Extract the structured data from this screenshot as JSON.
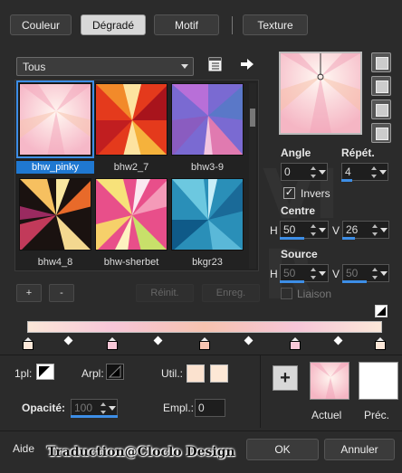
{
  "tabs": [
    {
      "label": "Couleur"
    },
    {
      "label": "Dégradé"
    },
    {
      "label": "Motif"
    },
    {
      "label": "Texture"
    }
  ],
  "category_dropdown": {
    "value": "Tous"
  },
  "gradients": [
    {
      "label": "bhw_pinky",
      "selected": true
    },
    {
      "label": "bhw2_7"
    },
    {
      "label": "bhw3-9"
    },
    {
      "label": "bhw4_8"
    },
    {
      "label": "bhw-sherbet"
    },
    {
      "label": "bkgr23"
    }
  ],
  "list_buttons": {
    "add": "+",
    "remove": "-",
    "reset": "Réinit.",
    "save": "Enreg."
  },
  "angle": {
    "label": "Angle",
    "value": "0"
  },
  "repeat": {
    "label": "Répét.",
    "value": "4"
  },
  "invert": {
    "label": "Invers",
    "checked": true
  },
  "center": {
    "label": "Centre",
    "h_label": "H",
    "h_value": "50",
    "v_label": "V",
    "v_value": "26"
  },
  "source": {
    "label": "Source",
    "h_label": "H",
    "h_value": "50",
    "v_label": "V",
    "v_value": "50"
  },
  "link": {
    "label": "Liaison",
    "checked": false
  },
  "bottom": {
    "one_pl_label": "1pl:",
    "arpl_label": "Arpl:",
    "util_label": "Util.:",
    "opacity_label": "Opacité:",
    "opacity_value": "100",
    "empl_label": "Empl.:",
    "empl_value": "0",
    "add_button": "+",
    "current_label": "Actuel",
    "previous_label": "Préc."
  },
  "footer": {
    "help": "Aide",
    "credit": "Traduction@Cloclo Design",
    "ok": "OK",
    "cancel": "Annuler"
  },
  "watermark": "VI R",
  "colors": {
    "selection_blue": "#3d8ee6",
    "util_swatch_1": "#fbe2cf",
    "util_swatch_2": "#fde8d6",
    "stop_pink": "#f8c8d8",
    "stop_peach": "#f6c3b0"
  }
}
